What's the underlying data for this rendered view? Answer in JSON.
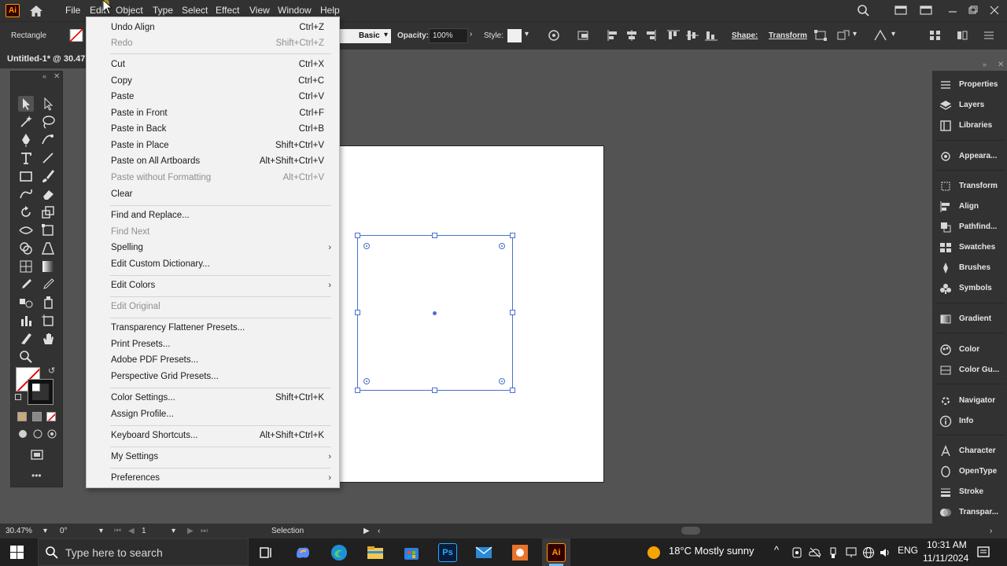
{
  "app": {
    "logo_text": "Ai",
    "document_tab": "Untitled-1* @ 30.47"
  },
  "menubar": {
    "items": [
      "File",
      "Edit",
      "Object",
      "Type",
      "Select",
      "Effect",
      "View",
      "Window",
      "Help"
    ]
  },
  "controlbar": {
    "tool_name": "Rectangle",
    "stroke_style": "Basic",
    "opacity_label": "Opacity:",
    "opacity_value": "100%",
    "style_label": "Style:",
    "shape_label": "Shape:",
    "transform_label": "Transform"
  },
  "edit_menu": {
    "items": [
      {
        "label": "Undo Align",
        "shortcut": "Ctrl+Z",
        "disabled": false
      },
      {
        "label": "Redo",
        "shortcut": "Shift+Ctrl+Z",
        "disabled": true
      },
      {
        "label": "Cut",
        "shortcut": "Ctrl+X",
        "disabled": false
      },
      {
        "label": "Copy",
        "shortcut": "Ctrl+C",
        "disabled": false
      },
      {
        "label": "Paste",
        "shortcut": "Ctrl+V",
        "disabled": false
      },
      {
        "label": "Paste in Front",
        "shortcut": "Ctrl+F",
        "disabled": false
      },
      {
        "label": "Paste in Back",
        "shortcut": "Ctrl+B",
        "disabled": false
      },
      {
        "label": "Paste in Place",
        "shortcut": "Shift+Ctrl+V",
        "disabled": false
      },
      {
        "label": "Paste on All Artboards",
        "shortcut": "Alt+Shift+Ctrl+V",
        "disabled": false
      },
      {
        "label": "Paste without Formatting",
        "shortcut": "Alt+Ctrl+V",
        "disabled": true
      },
      {
        "label": "Clear",
        "shortcut": "",
        "disabled": false
      },
      {
        "label": "Find and Replace...",
        "shortcut": "",
        "disabled": false
      },
      {
        "label": "Find Next",
        "shortcut": "",
        "disabled": true
      },
      {
        "label": "Spelling",
        "shortcut": "",
        "disabled": false,
        "submenu": true
      },
      {
        "label": "Edit Custom Dictionary...",
        "shortcut": "",
        "disabled": false
      },
      {
        "label": "Edit Colors",
        "shortcut": "",
        "disabled": false,
        "submenu": true
      },
      {
        "label": "Edit Original",
        "shortcut": "",
        "disabled": true
      },
      {
        "label": "Transparency Flattener Presets...",
        "shortcut": "",
        "disabled": false
      },
      {
        "label": "Print Presets...",
        "shortcut": "",
        "disabled": false
      },
      {
        "label": "Adobe PDF Presets...",
        "shortcut": "",
        "disabled": false
      },
      {
        "label": "Perspective Grid Presets...",
        "shortcut": "",
        "disabled": false
      },
      {
        "label": "Color Settings...",
        "shortcut": "Shift+Ctrl+K",
        "disabled": false
      },
      {
        "label": "Assign Profile...",
        "shortcut": "",
        "disabled": false
      },
      {
        "label": "Keyboard Shortcuts...",
        "shortcut": "Alt+Shift+Ctrl+K",
        "disabled": false
      },
      {
        "label": "My Settings",
        "shortcut": "",
        "disabled": false,
        "submenu": true
      },
      {
        "label": "Preferences",
        "shortcut": "",
        "disabled": false,
        "submenu": true
      }
    ]
  },
  "right_panel": {
    "items": [
      "Properties",
      "Layers",
      "Libraries",
      "Appeara...",
      "Transform",
      "Align",
      "Pathfind...",
      "Swatches",
      "Brushes",
      "Symbols",
      "Gradient",
      "Color",
      "Color Gu...",
      "Navigator",
      "Info",
      "Character",
      "OpenType",
      "Stroke",
      "Transpar..."
    ]
  },
  "statusbar": {
    "zoom": "30.47%",
    "rotation": "0°",
    "artboard_number": "1",
    "mode": "Selection"
  },
  "taskbar": {
    "search_placeholder": "Type here to search",
    "weather": "18°C  Mostly sunny",
    "language": "ENG",
    "time": "10:31 AM",
    "date": "11/11/2024",
    "ps_label": "Ps",
    "ai_label": "Ai"
  },
  "colors": {
    "accent_selection": "#4a6fd0",
    "illustrator_orange": "#ff9a00",
    "menu_bg": "#f2f2f2"
  }
}
